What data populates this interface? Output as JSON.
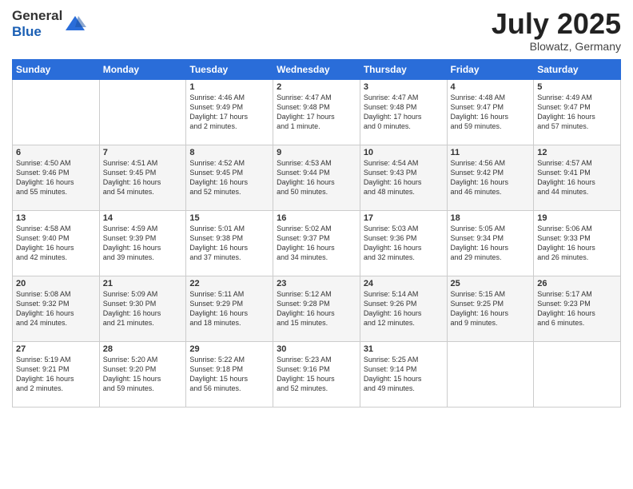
{
  "header": {
    "logo_line1": "General",
    "logo_line2": "Blue",
    "month": "July 2025",
    "location": "Blowatz, Germany"
  },
  "weekdays": [
    "Sunday",
    "Monday",
    "Tuesday",
    "Wednesday",
    "Thursday",
    "Friday",
    "Saturday"
  ],
  "weeks": [
    [
      {
        "day": "",
        "info": ""
      },
      {
        "day": "",
        "info": ""
      },
      {
        "day": "1",
        "info": "Sunrise: 4:46 AM\nSunset: 9:49 PM\nDaylight: 17 hours\nand 2 minutes."
      },
      {
        "day": "2",
        "info": "Sunrise: 4:47 AM\nSunset: 9:48 PM\nDaylight: 17 hours\nand 1 minute."
      },
      {
        "day": "3",
        "info": "Sunrise: 4:47 AM\nSunset: 9:48 PM\nDaylight: 17 hours\nand 0 minutes."
      },
      {
        "day": "4",
        "info": "Sunrise: 4:48 AM\nSunset: 9:47 PM\nDaylight: 16 hours\nand 59 minutes."
      },
      {
        "day": "5",
        "info": "Sunrise: 4:49 AM\nSunset: 9:47 PM\nDaylight: 16 hours\nand 57 minutes."
      }
    ],
    [
      {
        "day": "6",
        "info": "Sunrise: 4:50 AM\nSunset: 9:46 PM\nDaylight: 16 hours\nand 55 minutes."
      },
      {
        "day": "7",
        "info": "Sunrise: 4:51 AM\nSunset: 9:45 PM\nDaylight: 16 hours\nand 54 minutes."
      },
      {
        "day": "8",
        "info": "Sunrise: 4:52 AM\nSunset: 9:45 PM\nDaylight: 16 hours\nand 52 minutes."
      },
      {
        "day": "9",
        "info": "Sunrise: 4:53 AM\nSunset: 9:44 PM\nDaylight: 16 hours\nand 50 minutes."
      },
      {
        "day": "10",
        "info": "Sunrise: 4:54 AM\nSunset: 9:43 PM\nDaylight: 16 hours\nand 48 minutes."
      },
      {
        "day": "11",
        "info": "Sunrise: 4:56 AM\nSunset: 9:42 PM\nDaylight: 16 hours\nand 46 minutes."
      },
      {
        "day": "12",
        "info": "Sunrise: 4:57 AM\nSunset: 9:41 PM\nDaylight: 16 hours\nand 44 minutes."
      }
    ],
    [
      {
        "day": "13",
        "info": "Sunrise: 4:58 AM\nSunset: 9:40 PM\nDaylight: 16 hours\nand 42 minutes."
      },
      {
        "day": "14",
        "info": "Sunrise: 4:59 AM\nSunset: 9:39 PM\nDaylight: 16 hours\nand 39 minutes."
      },
      {
        "day": "15",
        "info": "Sunrise: 5:01 AM\nSunset: 9:38 PM\nDaylight: 16 hours\nand 37 minutes."
      },
      {
        "day": "16",
        "info": "Sunrise: 5:02 AM\nSunset: 9:37 PM\nDaylight: 16 hours\nand 34 minutes."
      },
      {
        "day": "17",
        "info": "Sunrise: 5:03 AM\nSunset: 9:36 PM\nDaylight: 16 hours\nand 32 minutes."
      },
      {
        "day": "18",
        "info": "Sunrise: 5:05 AM\nSunset: 9:34 PM\nDaylight: 16 hours\nand 29 minutes."
      },
      {
        "day": "19",
        "info": "Sunrise: 5:06 AM\nSunset: 9:33 PM\nDaylight: 16 hours\nand 26 minutes."
      }
    ],
    [
      {
        "day": "20",
        "info": "Sunrise: 5:08 AM\nSunset: 9:32 PM\nDaylight: 16 hours\nand 24 minutes."
      },
      {
        "day": "21",
        "info": "Sunrise: 5:09 AM\nSunset: 9:30 PM\nDaylight: 16 hours\nand 21 minutes."
      },
      {
        "day": "22",
        "info": "Sunrise: 5:11 AM\nSunset: 9:29 PM\nDaylight: 16 hours\nand 18 minutes."
      },
      {
        "day": "23",
        "info": "Sunrise: 5:12 AM\nSunset: 9:28 PM\nDaylight: 16 hours\nand 15 minutes."
      },
      {
        "day": "24",
        "info": "Sunrise: 5:14 AM\nSunset: 9:26 PM\nDaylight: 16 hours\nand 12 minutes."
      },
      {
        "day": "25",
        "info": "Sunrise: 5:15 AM\nSunset: 9:25 PM\nDaylight: 16 hours\nand 9 minutes."
      },
      {
        "day": "26",
        "info": "Sunrise: 5:17 AM\nSunset: 9:23 PM\nDaylight: 16 hours\nand 6 minutes."
      }
    ],
    [
      {
        "day": "27",
        "info": "Sunrise: 5:19 AM\nSunset: 9:21 PM\nDaylight: 16 hours\nand 2 minutes."
      },
      {
        "day": "28",
        "info": "Sunrise: 5:20 AM\nSunset: 9:20 PM\nDaylight: 15 hours\nand 59 minutes."
      },
      {
        "day": "29",
        "info": "Sunrise: 5:22 AM\nSunset: 9:18 PM\nDaylight: 15 hours\nand 56 minutes."
      },
      {
        "day": "30",
        "info": "Sunrise: 5:23 AM\nSunset: 9:16 PM\nDaylight: 15 hours\nand 52 minutes."
      },
      {
        "day": "31",
        "info": "Sunrise: 5:25 AM\nSunset: 9:14 PM\nDaylight: 15 hours\nand 49 minutes."
      },
      {
        "day": "",
        "info": ""
      },
      {
        "day": "",
        "info": ""
      }
    ]
  ]
}
